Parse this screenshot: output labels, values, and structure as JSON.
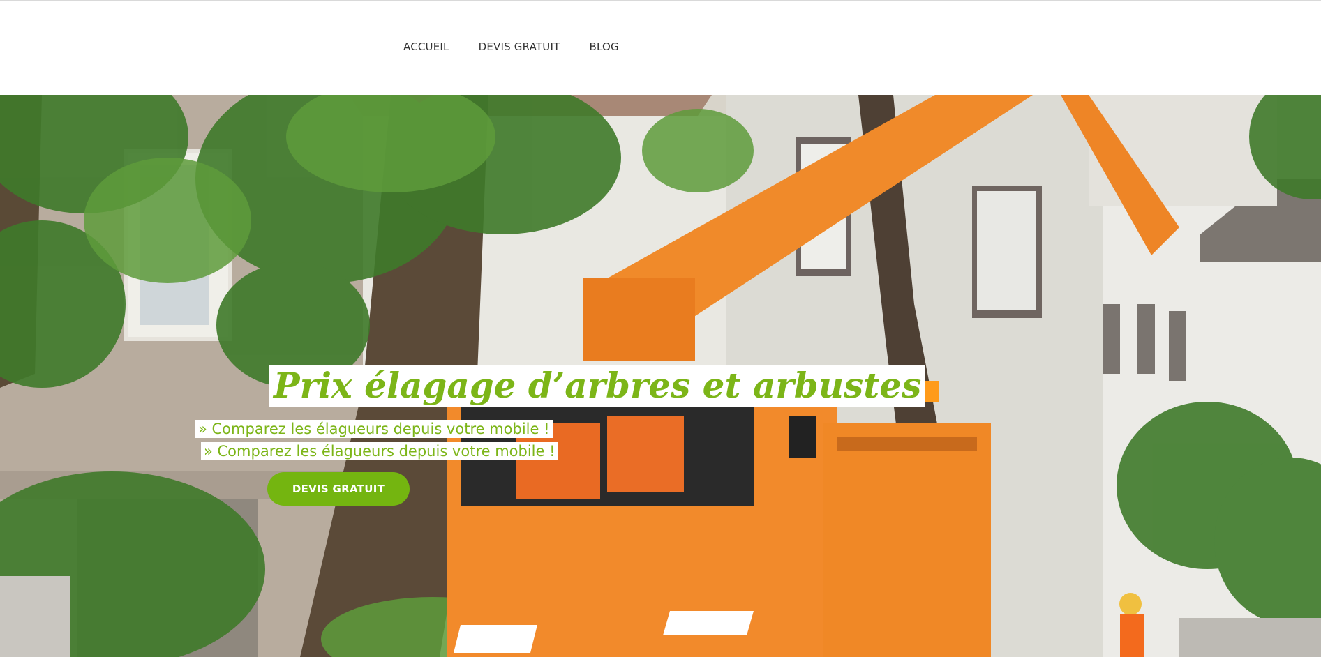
{
  "nav": {
    "items": [
      {
        "label": "ACCUEIL"
      },
      {
        "label": "DEVIS GRATUIT"
      },
      {
        "label": "BLOG"
      }
    ]
  },
  "hero": {
    "title": "Prix élagage d’arbres et arbustes",
    "subtitle_1": "» Comparez les élagueurs depuis votre mobile !",
    "subtitle_2": "» Comparez les élagueurs depuis votre mobile !",
    "cta_label": "DEVIS GRATUIT",
    "image_description_icon": "hero-photo"
  },
  "colors": {
    "accent": "#7cb518",
    "button": "#74b510",
    "truck": "#f08a2a",
    "nav_text": "#333333"
  }
}
